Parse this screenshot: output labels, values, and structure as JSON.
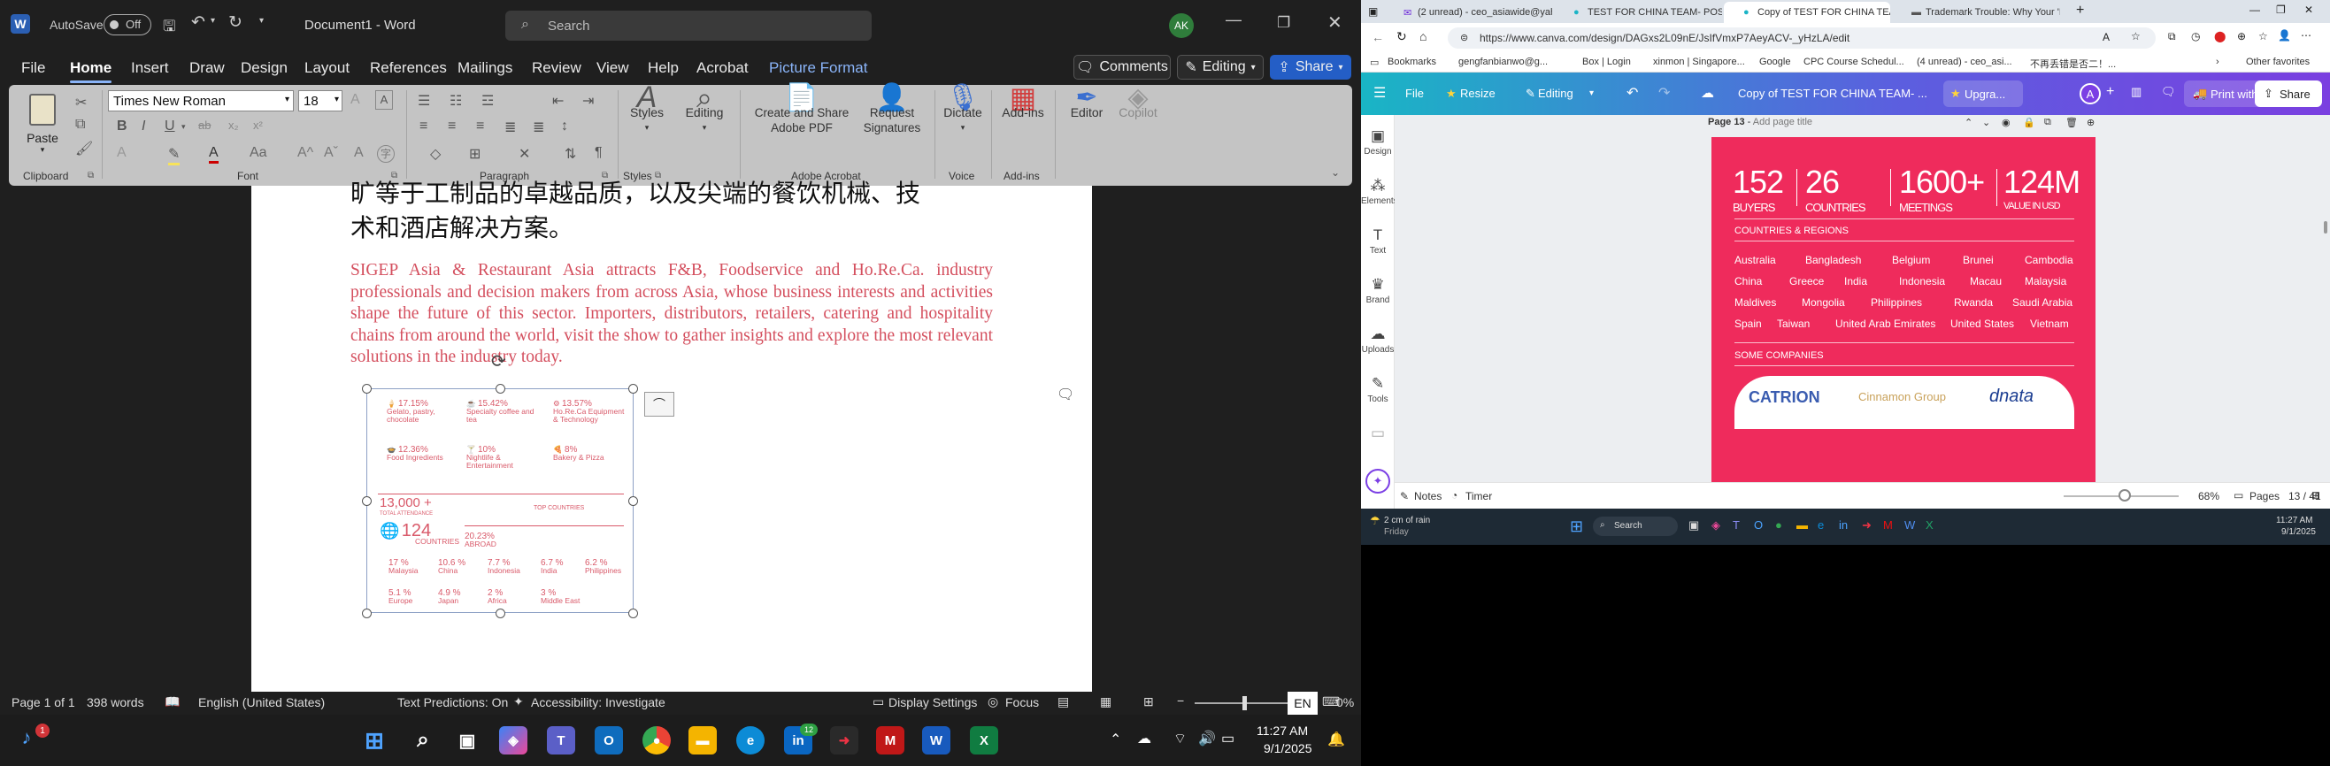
{
  "word": {
    "title": {
      "autosave": "AutoSave",
      "autosave_state": "Off",
      "doc_name": "Document1 - Word",
      "search_placeholder": "Search",
      "avatar": "AK"
    },
    "menu": [
      "File",
      "Home",
      "Insert",
      "Draw",
      "Design",
      "Layout",
      "References",
      "Mailings",
      "Review",
      "View",
      "Help",
      "Acrobat",
      "Picture Format"
    ],
    "comments": "Comments",
    "editing": "Editing",
    "share": "Share",
    "ribbon": {
      "paste": "Paste",
      "clipboard": "Clipboard",
      "font_name": "Times New Roman",
      "font_size": "18",
      "font": "Font",
      "paragraph": "Paragraph",
      "styles": "Styles",
      "styles_group": "Styles",
      "editing": "Editing",
      "create_share": "Create and Share Adobe PDF",
      "request_sig": "Request Signatures",
      "adobe_acrobat": "Adobe Acrobat",
      "dictate": "Dictate",
      "voice": "Voice",
      "addins": "Add-ins",
      "addins_group": "Add-ins",
      "editor": "Editor",
      "copilot": "Copilot"
    },
    "document": {
      "cn_line1": "旷等于工制品的卓越品质，以及尖端的餐饮机械、技",
      "cn_line2": "术和酒店解决方案。",
      "paragraph": "SIGEP Asia & Restaurant Asia attracts F&B, Foodservice and Ho.Re.Ca. industry professionals and decision makers from across Asia, whose business interests and activities shape the future of this sector. Importers, distributors, retailers, catering and hospitality chains from around the world, visit the show to gather insights and explore the most relevant solutions in the industry today.",
      "infographic": {
        "row1": [
          {
            "v": "17.15%",
            "l": "Gelato, pastry, chocolate"
          },
          {
            "v": "15.42%",
            "l": "Specialty coffee and tea"
          },
          {
            "v": "13.57%",
            "l": "Ho.Re.Ca Equipment & Technology"
          }
        ],
        "row2": [
          {
            "v": "12.36%",
            "l": "Food Ingredients"
          },
          {
            "v": "10%",
            "l": "Nightlife & Entertainment"
          },
          {
            "v": "8%",
            "l": "Bakery & Pizza"
          }
        ],
        "attendance": "13,000 +",
        "attendance_label": "TOTAL ATTENDANCE",
        "top_countries": "TOP COUNTRIES",
        "countries": "124",
        "countries_label": "COUNTRIES",
        "abroad": "20.23%",
        "abroad_label": "ABROAD",
        "row3": [
          {
            "v": "17 %",
            "l": "Malaysia"
          },
          {
            "v": "10.6 %",
            "l": "China"
          },
          {
            "v": "7.7 %",
            "l": "Indonesia"
          },
          {
            "v": "6.7 %",
            "l": "India"
          },
          {
            "v": "6.2 %",
            "l": "Philippines"
          }
        ],
        "row4": [
          {
            "v": "5.1 %",
            "l": "Europe"
          },
          {
            "v": "4.9 %",
            "l": "Japan"
          },
          {
            "v": "2 %",
            "l": "Africa"
          },
          {
            "v": "3 %",
            "l": "Middle East"
          }
        ]
      }
    },
    "status": {
      "page": "Page 1 of 1",
      "words": "398 words",
      "language": "English (United States)",
      "predictions": "Text Predictions: On",
      "accessibility": "Accessibility: Investigate",
      "display": "Display Settings",
      "focus": "Focus",
      "lang_badge": "EN",
      "zoom": "0%"
    },
    "taskbar": {
      "time": "11:27 AM",
      "date": "9/1/2025",
      "badge": "1",
      "linkedin_badge": "12"
    }
  },
  "browser": {
    "tabs": [
      {
        "title": "(2 unread) - ceo_asiawide@yaho"
      },
      {
        "title": "TEST FOR CHINA TEAM- POST Sl"
      },
      {
        "title": "Copy of TEST FOR CHINA TEAM-"
      },
      {
        "title": "Trademark Trouble: Why Your 'Kit"
      }
    ],
    "url": "https://www.canva.com/design/DAGxs2L09nE/JsIfVmxP7AeyACV-_yHzLA/edit",
    "bookmarks": [
      "Bookmarks",
      "gengfanbianwo@g...",
      "Box | Login",
      "xinmon | Singapore...",
      "Google",
      "CPC Course Schedul...",
      "(4 unread) - ceo_asi...",
      "不再丢错是否二！..."
    ],
    "other_favorites": "Other favorites",
    "canva": {
      "file": "File",
      "resize": "Resize",
      "editing": "Editing",
      "doc_title": "Copy of TEST FOR CHINA TEAM- ...",
      "upgrade": "Upgra...",
      "avatar": "A",
      "print": "Print with Canva",
      "share": "Share",
      "sidebar": [
        "Design",
        "Elements",
        "Text",
        "Brand",
        "Uploads",
        "Tools"
      ],
      "page_label": "Page 13",
      "page_title_placeholder": "Add page title",
      "stats": [
        {
          "big": "152",
          "small": "BUYERS"
        },
        {
          "big": "26",
          "small": "COUNTRIES"
        },
        {
          "big": "1600+",
          "small": "MEETINGS"
        },
        {
          "big": "124M",
          "small": "VALUE IN USD"
        }
      ],
      "countries_heading": "COUNTRIES & REGIONS",
      "countries": [
        [
          "Australia",
          "Bangladesh",
          "Belgium",
          "Brunei",
          "Cambodia"
        ],
        [
          "China",
          "Greece",
          "India",
          "Indonesia",
          "Macau",
          "Malaysia"
        ],
        [
          "Maldives",
          "Mongolia",
          "Philippines",
          "Rwanda",
          "Saudi Arabia"
        ],
        [
          "Spain",
          "Taiwan",
          "United Arab Emirates",
          "United States",
          "Vietnam"
        ]
      ],
      "companies_heading": "SOME COMPANIES",
      "companies": [
        "CATRION",
        "Cinnamon Group",
        "dnata"
      ],
      "notes": "Notes",
      "timer": "Timer",
      "zoom": "68%",
      "pages": "Pages",
      "page_count": "13 / 41"
    },
    "taskbar": {
      "weather": "2 cm of rain",
      "weather_sub": "Friday",
      "search": "Search",
      "time": "11:27 AM",
      "date": "9/1/2025"
    }
  }
}
